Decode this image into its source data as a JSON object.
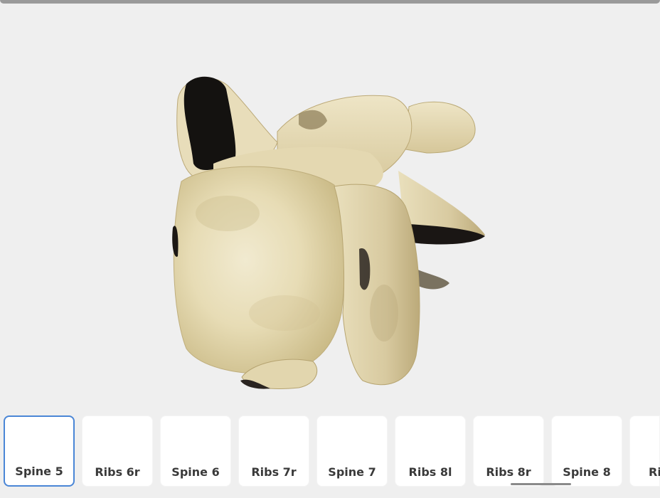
{
  "viewer": {
    "model_name": "vertebra-3d-model",
    "background": "#efefef"
  },
  "thumbnails": {
    "selected_index": 0,
    "accent_color": "#4a86d6",
    "items": [
      {
        "label": "Spine 5"
      },
      {
        "label": "Ribs 6r"
      },
      {
        "label": "Spine 6"
      },
      {
        "label": "Ribs 7r"
      },
      {
        "label": "Spine 7"
      },
      {
        "label": "Ribs 8l"
      },
      {
        "label": "Ribs 8r"
      },
      {
        "label": "Spine 8"
      },
      {
        "label": "Ri"
      }
    ]
  }
}
